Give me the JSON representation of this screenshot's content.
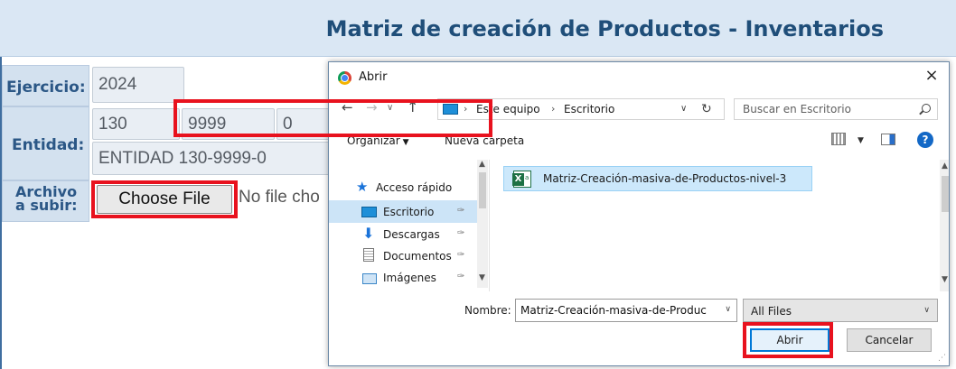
{
  "page": {
    "title": "Matriz de creación de Productos - Inventarios",
    "labels": {
      "ejercicio": "Ejercicio:",
      "entidad": "Entidad:",
      "archivo": "Archivo a subir:"
    },
    "fields": {
      "ejercicio": "2024",
      "entidad_code1": "130",
      "entidad_code2": "9999",
      "entidad_code3": "0",
      "entidad_name": "ENTIDAD 130-9999-0"
    },
    "choose_file_label": "Choose File",
    "no_file_text": "No file cho"
  },
  "dialog": {
    "title": "Abrir",
    "close_symbol": "×",
    "address": {
      "crumbs": [
        "Este equipo",
        "Escritorio"
      ],
      "separator": "›"
    },
    "search_placeholder": "Buscar en Escritorio",
    "toolbar": {
      "organize": "Organizar",
      "new_folder": "Nueva carpeta"
    },
    "nav_items": [
      {
        "label": "Acceso rápido",
        "icon": "star-icon"
      },
      {
        "label": "Escritorio",
        "icon": "desktop-folder-icon",
        "selected": true
      },
      {
        "label": "Descargas",
        "icon": "download-icon"
      },
      {
        "label": "Documentos",
        "icon": "documents-icon"
      },
      {
        "label": "Imágenes",
        "icon": "images-icon"
      }
    ],
    "files": [
      {
        "name": "Matriz-Creación-masiva-de-Productos-nivel-3",
        "icon": "excel-icon",
        "selected": true
      }
    ],
    "filename_label": "Nombre:",
    "filename_value": "Matriz-Creación-masiva-de-Produc",
    "filetype": "All Files",
    "open_label": "Abrir",
    "cancel_label": "Cancelar"
  },
  "colors": {
    "header_bg": "#dae7f4",
    "title": "#1f4e79",
    "label_bg": "#d3e1ef",
    "highlight": "#e8121e",
    "selection": "#cce8fb",
    "accent": "#0078d7"
  }
}
